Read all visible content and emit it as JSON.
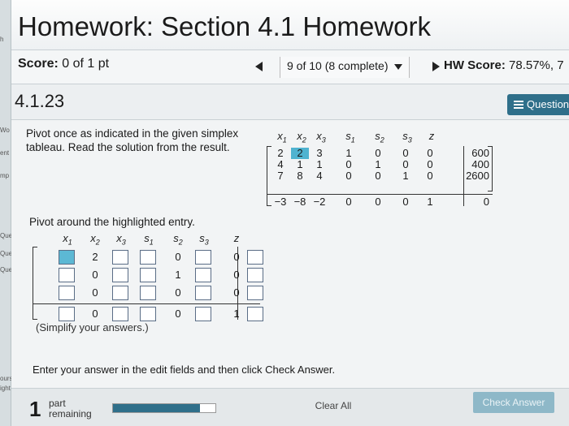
{
  "left_strip": [
    "h",
    "Wo",
    "ent",
    "mp",
    "Que",
    "Que",
    "Que",
    "ourse",
    "ight 20"
  ],
  "header": {
    "title": "Homework: Section 4.1 Homework"
  },
  "score_bar": {
    "score_label": "Score:",
    "score_value": "0 of 1 pt",
    "nav_position": "9 of 10 (8 complete)",
    "hw_score_label": "HW Score:",
    "hw_score_value": "78.57%, 7"
  },
  "problem": {
    "id": "4.1.23",
    "question_button": "Question",
    "instruction": "Pivot once as indicated in the given simplex tableau. Read the solution from the result."
  },
  "tableau": {
    "headers": [
      "x",
      "x",
      "x",
      "s",
      "s",
      "s",
      "z"
    ],
    "subscripts": [
      "1",
      "2",
      "3",
      "1",
      "2",
      "3",
      ""
    ],
    "rows": [
      [
        "2",
        "2",
        "3",
        "1",
        "0",
        "0",
        "0",
        "600"
      ],
      [
        "4",
        "1",
        "1",
        "0",
        "1",
        "0",
        "0",
        "400"
      ],
      [
        "7",
        "8",
        "4",
        "0",
        "0",
        "1",
        "0",
        "2600"
      ],
      [
        "−3",
        "−8",
        "−2",
        "0",
        "0",
        "0",
        "1",
        "0"
      ]
    ],
    "pivot": [
      0,
      1
    ]
  },
  "pivot_instruction": "Pivot around the highlighted entry.",
  "answer_grid": {
    "headers": [
      "x",
      "x",
      "x",
      "s",
      "s",
      "s",
      "z"
    ],
    "subscripts": [
      "1",
      "2",
      "3",
      "1",
      "2",
      "3",
      ""
    ],
    "col2_values": [
      "2",
      "0",
      "0",
      "0"
    ],
    "s2_values": [
      "0",
      "1",
      "0",
      "0"
    ],
    "z_values": [
      "0",
      "0",
      "0",
      "1"
    ]
  },
  "simplify_note": "(Simplify your answers.)",
  "enter_message": "Enter your answer in the edit fields and then click Check Answer.",
  "footer": {
    "parts_count": "1",
    "parts_label_1": "part",
    "parts_label_2": "remaining",
    "progress_fraction": 0.85,
    "clear_all": "Clear All",
    "check_answer": "Check Answer"
  },
  "colors": {
    "accent": "#2f6f8a",
    "highlight": "#4fb3d0"
  }
}
